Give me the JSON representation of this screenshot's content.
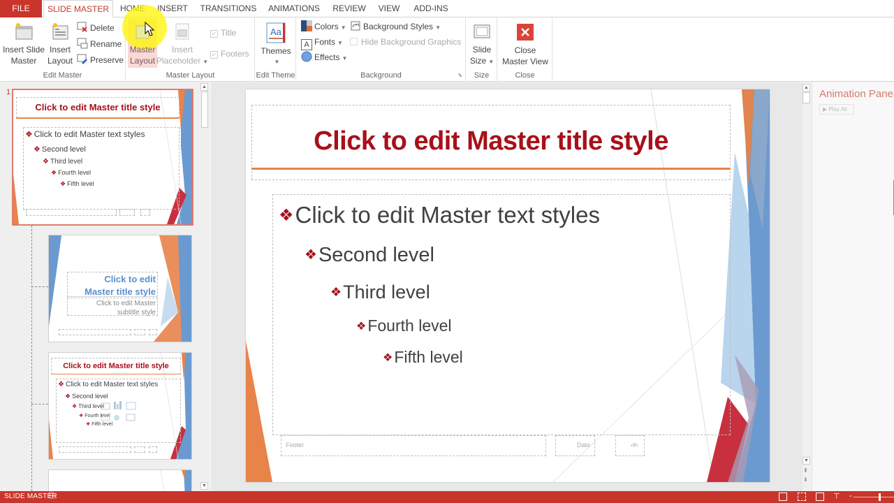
{
  "tabs": {
    "file": "FILE",
    "items": [
      "SLIDE MASTER",
      "HOME",
      "INSERT",
      "TRANSITIONS",
      "ANIMATIONS",
      "REVIEW",
      "VIEW",
      "ADD-INS"
    ],
    "active": "SLIDE MASTER"
  },
  "ribbon": {
    "edit_master": {
      "label": "Edit Master",
      "insert_slide_master": [
        "Insert Slide",
        "Master"
      ],
      "insert_layout": [
        "Insert",
        "Layout"
      ],
      "delete": "Delete",
      "rename": "Rename",
      "preserve": "Preserve"
    },
    "master_layout": {
      "label": "Master Layout",
      "master_layout_btn": [
        "Master",
        "Layout"
      ],
      "insert_placeholder": [
        "Insert",
        "Placeholder"
      ],
      "title_check": "Title",
      "footers_check": "Footers"
    },
    "edit_theme": {
      "label": "Edit Theme",
      "themes": "Themes"
    },
    "background": {
      "label": "Background",
      "colors": "Colors",
      "fonts": "Fonts",
      "effects": "Effects",
      "background_styles": "Background Styles",
      "hide_bg_graphics": "Hide Background Graphics"
    },
    "size": {
      "label": "Size",
      "slide_size": [
        "Slide",
        "Size"
      ]
    },
    "close": {
      "label": "Close",
      "close_master_view": [
        "Close",
        "Master View"
      ]
    }
  },
  "thumbnails": {
    "slide_number": "1",
    "master": {
      "title": "Click to edit Master title style",
      "levels": [
        "Click to edit Master text styles",
        "Second level",
        "Third level",
        "Fourth level",
        "Fifth level"
      ]
    },
    "title_layout": {
      "title_lines": [
        "Click to edit",
        "Master title style"
      ],
      "subtitle_lines": [
        "Click to edit Master",
        "subtitle style"
      ]
    },
    "content_layout": {
      "title": "Click to edit Master title style",
      "levels": [
        "Click to edit Master text styles",
        "Second level",
        "Third level",
        "Fourth level",
        "Fifth level"
      ]
    }
  },
  "slide": {
    "title": "Click to edit Master title style",
    "bullet_glyph": "❖",
    "levels": [
      "Click to edit Master text styles",
      "Second level",
      "Third level",
      "Fourth level",
      "Fifth level"
    ],
    "footer": "Footer",
    "date": "Date",
    "slide_num": "‹#›"
  },
  "animation_pane": {
    "title": "Animation Pane",
    "play_all": "Play All"
  },
  "status": {
    "mode": "SLIDE MASTER"
  },
  "colors": {
    "accent": "#c9352b",
    "title_red": "#a8101a",
    "orange": "#e8834a",
    "blue": "#6a9ad0"
  }
}
